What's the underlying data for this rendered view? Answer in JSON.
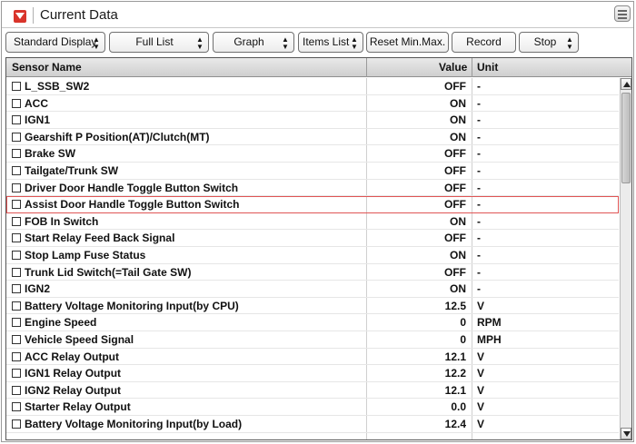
{
  "window": {
    "title": "Current Data"
  },
  "toolbar": {
    "buttons": [
      {
        "label": "Standard Display",
        "has_arrows": true
      },
      {
        "label": "Full List",
        "has_arrows": true
      },
      {
        "label": "Graph",
        "has_arrows": true
      },
      {
        "label": "Items List",
        "has_arrows": true
      },
      {
        "label": "Reset Min.Max.",
        "has_arrows": false
      },
      {
        "label": "Record",
        "has_arrows": false
      },
      {
        "label": "Stop",
        "has_arrows": true
      }
    ]
  },
  "table": {
    "headers": {
      "name": "Sensor Name",
      "value": "Value",
      "unit": "Unit"
    },
    "selected_row": 7,
    "rows": [
      {
        "name": "L_SSB_SW2",
        "value": "OFF",
        "unit": "-"
      },
      {
        "name": "ACC",
        "value": "ON",
        "unit": "-"
      },
      {
        "name": "IGN1",
        "value": "ON",
        "unit": "-"
      },
      {
        "name": "Gearshift P Position(AT)/Clutch(MT)",
        "value": "ON",
        "unit": "-"
      },
      {
        "name": "Brake SW",
        "value": "OFF",
        "unit": "-"
      },
      {
        "name": "Tailgate/Trunk SW",
        "value": "OFF",
        "unit": "-"
      },
      {
        "name": "Driver Door Handle Toggle Button Switch",
        "value": "OFF",
        "unit": "-"
      },
      {
        "name": "Assist Door Handle Toggle Button Switch",
        "value": "OFF",
        "unit": "-"
      },
      {
        "name": "FOB In Switch",
        "value": "ON",
        "unit": "-"
      },
      {
        "name": "Start Relay Feed Back Signal",
        "value": "OFF",
        "unit": "-"
      },
      {
        "name": "Stop Lamp Fuse Status",
        "value": "ON",
        "unit": "-"
      },
      {
        "name": "Trunk Lid Switch(=Tail Gate SW)",
        "value": "OFF",
        "unit": "-"
      },
      {
        "name": "IGN2",
        "value": "ON",
        "unit": "-"
      },
      {
        "name": "Battery Voltage Monitoring Input(by CPU)",
        "value": "12.5",
        "unit": "V"
      },
      {
        "name": "Engine Speed",
        "value": "0",
        "unit": "RPM"
      },
      {
        "name": "Vehicle Speed Signal",
        "value": "0",
        "unit": "MPH"
      },
      {
        "name": "ACC Relay Output",
        "value": "12.1",
        "unit": "V"
      },
      {
        "name": "IGN1 Relay Output",
        "value": "12.2",
        "unit": "V"
      },
      {
        "name": "IGN2 Relay Output",
        "value": "12.1",
        "unit": "V"
      },
      {
        "name": "Starter Relay Output",
        "value": "0.0",
        "unit": "V"
      },
      {
        "name": "Battery Voltage Monitoring Input(by Load)",
        "value": "12.4",
        "unit": "V"
      }
    ]
  },
  "colors": {
    "title_icon": "#d9342b",
    "selection_outline": "#e05555"
  }
}
